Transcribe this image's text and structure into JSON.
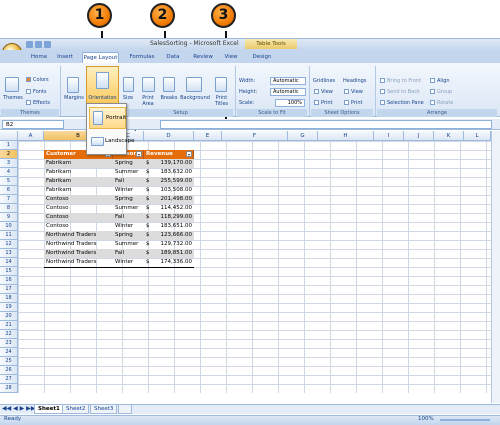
{
  "callouts": [
    "1",
    "2",
    "3"
  ],
  "window": {
    "title": "SalesSorting - Microsoft Excel",
    "context_tab": "Table Tools"
  },
  "tabs": [
    "Home",
    "Insert",
    "Page Layout",
    "Formulas",
    "Data",
    "Review",
    "View",
    "Design"
  ],
  "ribbon": {
    "themes": {
      "themes_label": "Themes",
      "colors": "Colors",
      "fonts": "Fonts",
      "effects": "Effects",
      "group": "Themes"
    },
    "page_setup": {
      "margins": "Margins",
      "orientation": "Orientation",
      "size": "Size",
      "print_area": "Print Area",
      "breaks": "Breaks",
      "background": "Background",
      "print_titles": "Print Titles",
      "group": "Setup"
    },
    "scale": {
      "width_label": "Width:",
      "width_value": "Automatic",
      "height_label": "Height:",
      "height_value": "Automatic",
      "scale_label": "Scale:",
      "scale_value": "100%",
      "group": "Scale to Fit"
    },
    "sheet_options": {
      "gridlines": "Gridlines",
      "headings": "Headings",
      "view": "View",
      "print": "Print",
      "group": "Sheet Options"
    },
    "arrange": {
      "bring_front": "Bring to Front",
      "send_back": "Send to Back",
      "selection_pane": "Selection Pane",
      "align": "Align",
      "group_btn": "Group",
      "rotate": "Rotate",
      "group": "Arrange"
    }
  },
  "orientation_menu": {
    "portrait": "Portrait",
    "landscape": "Landscape"
  },
  "formula_bar": {
    "name_box": "B2"
  },
  "columns": [
    "A",
    "B",
    "C",
    "D",
    "E",
    "F",
    "G",
    "H",
    "I",
    "J",
    "K",
    "L"
  ],
  "rows": [
    "1",
    "2",
    "3",
    "4",
    "5",
    "6",
    "7",
    "8",
    "9",
    "10",
    "11",
    "12",
    "13",
    "14",
    "15",
    "16",
    "17",
    "18",
    "19",
    "20",
    "21",
    "22",
    "23",
    "24",
    "25",
    "26",
    "27",
    "28"
  ],
  "table": {
    "headers": [
      "Customer",
      "Season",
      "Revenue"
    ],
    "rows": [
      [
        "Fabrikam",
        "Spring",
        "$",
        "139,170.00"
      ],
      [
        "Fabrikam",
        "Summer",
        "$",
        "183,632.00"
      ],
      [
        "Fabrikam",
        "Fall",
        "$",
        "255,599.00"
      ],
      [
        "Fabrikam",
        "Winter",
        "$",
        "103,508.00"
      ],
      [
        "Contoso",
        "Spring",
        "$",
        "201,498.00"
      ],
      [
        "Contoso",
        "Summer",
        "$",
        "114,452.00"
      ],
      [
        "Contoso",
        "Fall",
        "$",
        "118,299.00"
      ],
      [
        "Contoso",
        "Winter",
        "$",
        "183,651.00"
      ],
      [
        "Northwind Traders",
        "Spring",
        "$",
        "123,666.00"
      ],
      [
        "Northwind Traders",
        "Summer",
        "$",
        "129,732.00"
      ],
      [
        "Northwind Traders",
        "Fall",
        "$",
        "189,851.00"
      ],
      [
        "Northwind Traders",
        "Winter",
        "$",
        "174,336.00"
      ]
    ]
  },
  "sheets": [
    "Sheet1",
    "Sheet2",
    "Sheet3"
  ],
  "status": {
    "ready": "Ready",
    "zoom": "100%"
  }
}
